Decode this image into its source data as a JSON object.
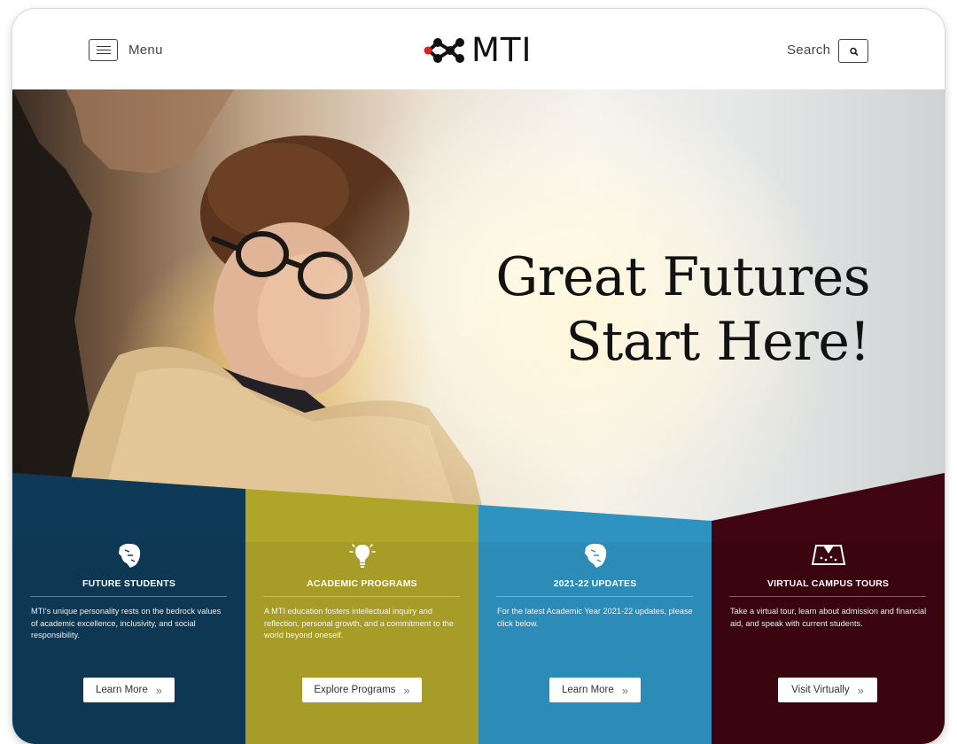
{
  "header": {
    "menu_label": "Menu",
    "logo_text": "MTI",
    "search_label": "Search"
  },
  "hero": {
    "title_line1": "Great Futures",
    "title_line2": "Start Here!"
  },
  "cards": [
    {
      "icon": "lion-head-icon",
      "title": "FUTURE STUDENTS",
      "description": "MTI's unique personality rests on the bedrock values of academic excellence, inclusivity, and social responsibility.",
      "button_label": "Learn More",
      "color": "#0e3a57"
    },
    {
      "icon": "lightbulb-icon",
      "title": "ACADEMIC PROGRAMS",
      "description": "A MTI education fosters intellectual inquiry and reflection, personal growth, and a commitment to the world beyond oneself.",
      "button_label": "Explore Programs",
      "color": "#afa52a"
    },
    {
      "icon": "lion-head-icon",
      "title": "2021-22 UPDATES",
      "description": "For the latest Academic Year 2021-22 updates, please click below.",
      "button_label": "Learn More",
      "color": "#2f93c1"
    },
    {
      "icon": "map-icon",
      "title": "VIRTUAL CAMPUS TOURS",
      "description": "Take a virtual tour, learn about admission and financial aid, and speak with current students.",
      "button_label": "Visit Virtually",
      "color": "#3f0611"
    }
  ],
  "colors": {
    "accent_red": "#d0281f",
    "text_dark": "#121212"
  }
}
